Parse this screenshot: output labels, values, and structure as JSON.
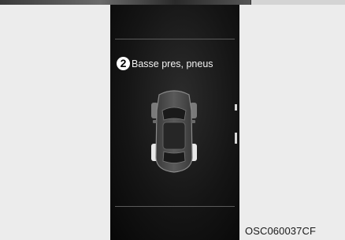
{
  "display": {
    "warning_number": "2",
    "warning_text": "Basse pres, pneus",
    "car_icon": "car-top-view-tire-pressure-icon"
  },
  "figure": {
    "reference_code": "OSC060037CF"
  },
  "colors": {
    "page_background": "#ececec",
    "display_background": "#151515",
    "text": "#f2f2f2",
    "tire_highlight": "#e8e8e8"
  }
}
